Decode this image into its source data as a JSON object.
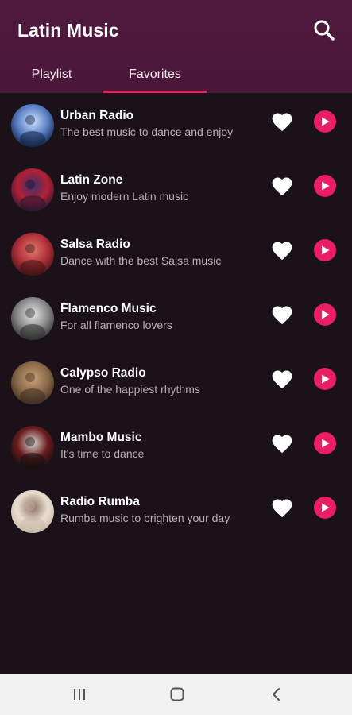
{
  "app": {
    "title": "Latin Music"
  },
  "tabs": [
    {
      "label": "Playlist",
      "selected": false
    },
    {
      "label": "Favorites",
      "selected": true
    }
  ],
  "colors": {
    "accent": "#e91e63",
    "header": "#4e1a3e",
    "background": "#1b1119"
  },
  "stations": [
    {
      "title": "Urban Radio",
      "subtitle": "The best music to dance and enjoy",
      "favorite": true,
      "thumb": [
        "#0b1e3d",
        "#5a7fc4",
        "#cfe2ff"
      ]
    },
    {
      "title": "Latin Zone",
      "subtitle": "Enjoy modern Latin music",
      "favorite": true,
      "thumb": [
        "#1b1730",
        "#b32035",
        "#3a2f6b"
      ]
    },
    {
      "title": "Salsa Radio",
      "subtitle": "Dance with the best Salsa music",
      "favorite": true,
      "thumb": [
        "#3a1114",
        "#b0303a",
        "#e07a6b"
      ]
    },
    {
      "title": "Flamenco Music",
      "subtitle": "For all flamenco lovers",
      "favorite": true,
      "thumb": [
        "#2a2a2a",
        "#8a8a8a",
        "#e8e8e8"
      ]
    },
    {
      "title": "Calypso Radio",
      "subtitle": "One of the happiest rhythms",
      "favorite": true,
      "thumb": [
        "#3b2a20",
        "#8a6a4a",
        "#c9a37a"
      ]
    },
    {
      "title": "Mambo Music",
      "subtitle": "It's time to dance",
      "favorite": true,
      "thumb": [
        "#0f0f0f",
        "#6a1b1b",
        "#d8d8d8"
      ]
    },
    {
      "title": "Radio Rumba",
      "subtitle": "Rumba music to brighten your day",
      "favorite": true,
      "thumb": [
        "#c8b8a8",
        "#e9ddd0",
        "#8a6e5e"
      ]
    }
  ],
  "icons": {
    "search": "search-icon",
    "favorite": "heart-icon",
    "play": "play-icon",
    "recents": "recents-icon",
    "home": "home-icon",
    "back": "back-icon"
  }
}
